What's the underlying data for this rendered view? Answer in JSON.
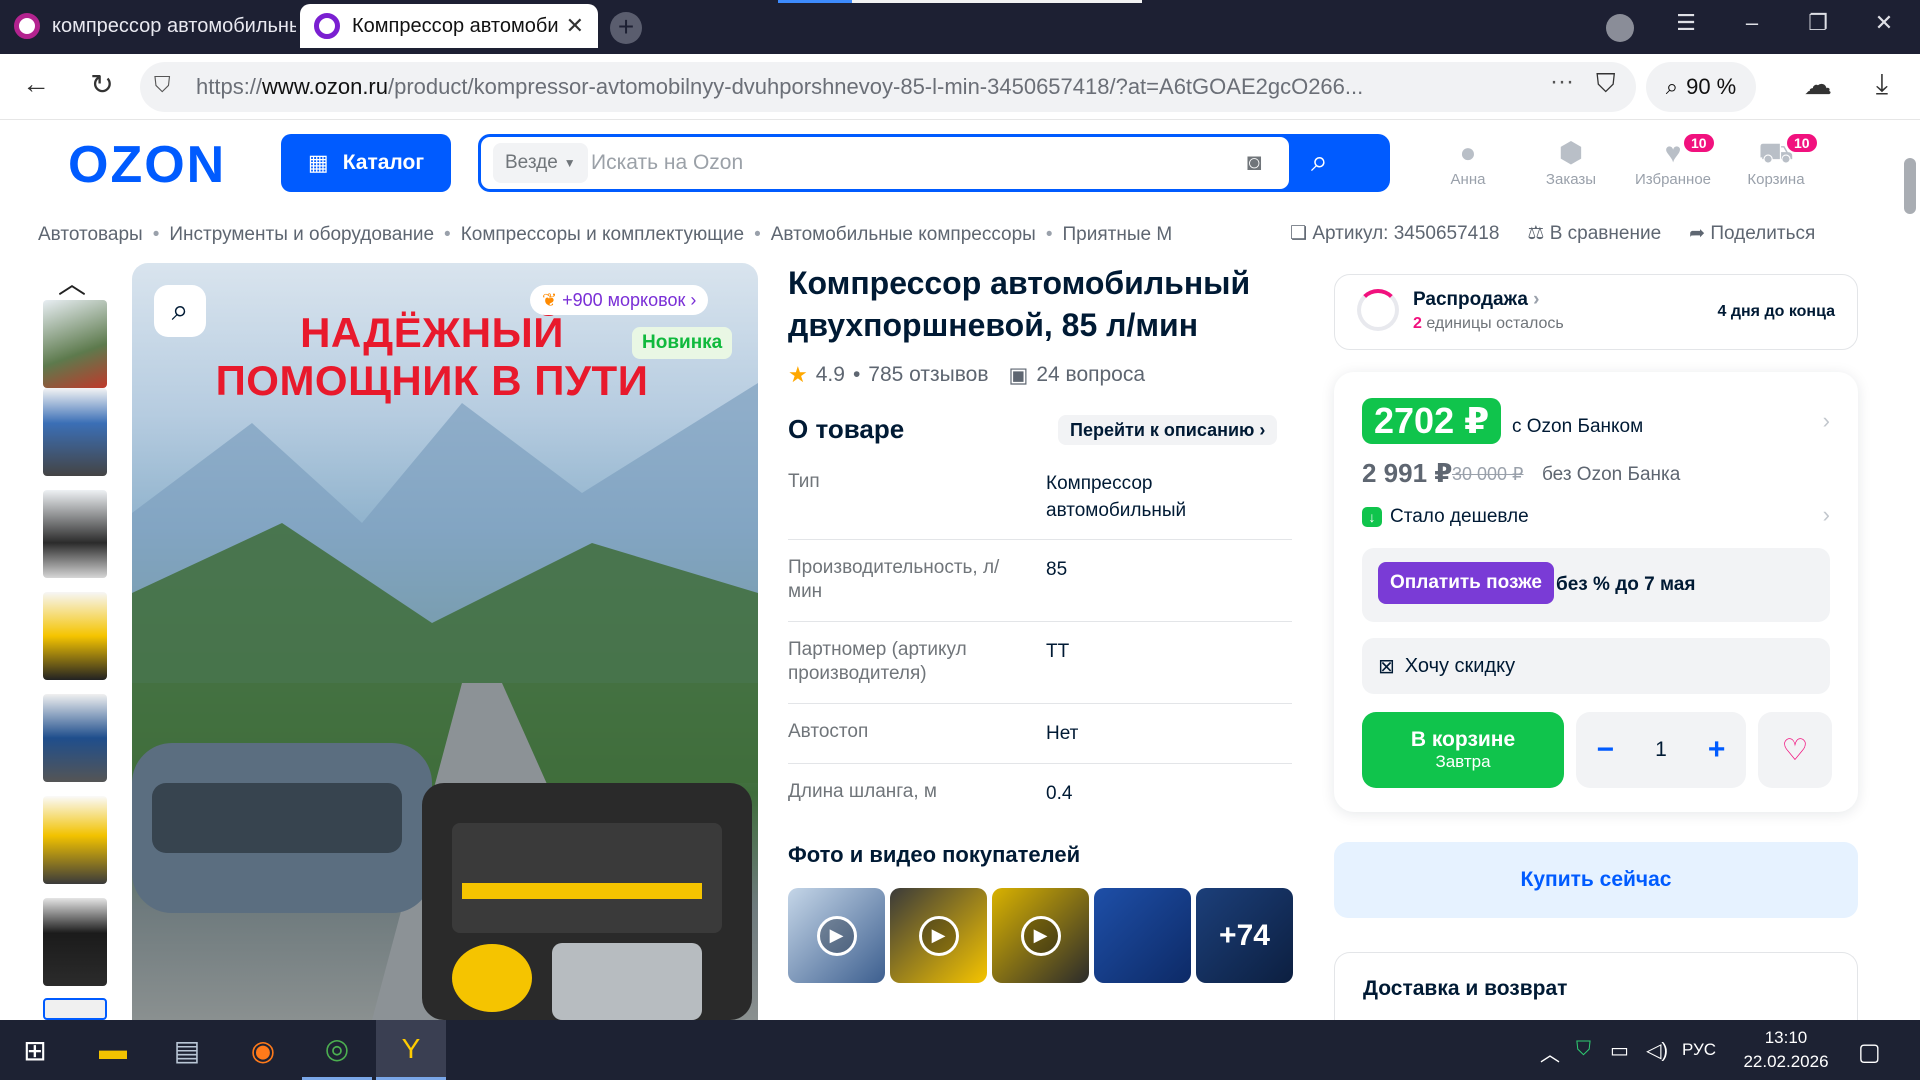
{
  "browser": {
    "tabs": [
      {
        "title": "компрессор автомобильный"
      },
      {
        "title": "Компрессор автомобильный"
      }
    ],
    "url_prefix": "https://",
    "url_domain": "www.ozon.ru",
    "url_path": "/product/kompressor-avtomobilnyy-dvuhporshnevoy-85-l-min-3450657418/?at=A6tGOAE2gcO266...",
    "zoom": "90 %"
  },
  "header": {
    "logo": "OZON",
    "catalog_label": "Каталог",
    "search_scope": "Везде",
    "search_placeholder": "Искать на Ozon",
    "user_label": "Анна",
    "orders_label": "Заказы",
    "favorites_label": "Избранное",
    "favorites_count": "10",
    "cart_label": "Корзина",
    "cart_count": "10"
  },
  "breadcrumbs": [
    "Автотовары",
    "Инструменты и оборудование",
    "Компрессоры и комплектующие",
    "Автомобильные компрессоры",
    "Приятные М"
  ],
  "actions": {
    "artikul": "Артикул: 3450657418",
    "compare": "В сравнение",
    "share": "Поделиться"
  },
  "image": {
    "headline": "НАДЁЖНЫЙ ПОМОЩНИК В ПУТИ",
    "carrot_bonus": "+900 морковок",
    "new_badge": "Новинка"
  },
  "product": {
    "title": "Компрессор автомобильный двухпоршневой, 85 л/мин",
    "rating": "4.9",
    "reviews": "785 отзывов",
    "questions": "24 вопроса",
    "about_title": "О товаре",
    "go_to_description": "Перейти к описанию",
    "specs": [
      {
        "key": "Тип",
        "value": "Компрессор автомобильный"
      },
      {
        "key": "Производительность, л/мин",
        "value": "85"
      },
      {
        "key": "Партномер (артикул производителя)",
        "value": "ТТ"
      },
      {
        "key": "Автостоп",
        "value": "Нет"
      },
      {
        "key": "Длина шланга, м",
        "value": "0.4"
      }
    ],
    "buyer_photos_title": "Фото и видео покупателей",
    "more_photos": "+74"
  },
  "sale": {
    "title": "Распродажа",
    "remaining_count": "2",
    "remaining_text": "единицы осталось",
    "ends": "4 дня до конца"
  },
  "price": {
    "bank_price": "2702 ₽",
    "with_bank": "с Ozon Банком",
    "regular_price": "2 991 ₽",
    "old_price": "30 000 ₽",
    "without_bank": "без Ozon Банка",
    "cheaper": "Стало дешевле",
    "pay_later_btn": "Оплатить позже",
    "pay_later_text": "без % до 7 мая",
    "want_discount": "Хочу скидку",
    "in_cart": "В корзине",
    "delivery_day": "Завтра",
    "quantity": "1",
    "buy_now": "Купить сейчас",
    "delivery_title": "Доставка и возврат"
  },
  "taskbar": {
    "lang": "РУС",
    "time": "13:10",
    "date": "22.02.2026"
  },
  "colors": {
    "ozon_blue": "#005bff",
    "green": "#10c44c",
    "pink": "#f1117e",
    "purple": "#7a3bd6"
  }
}
